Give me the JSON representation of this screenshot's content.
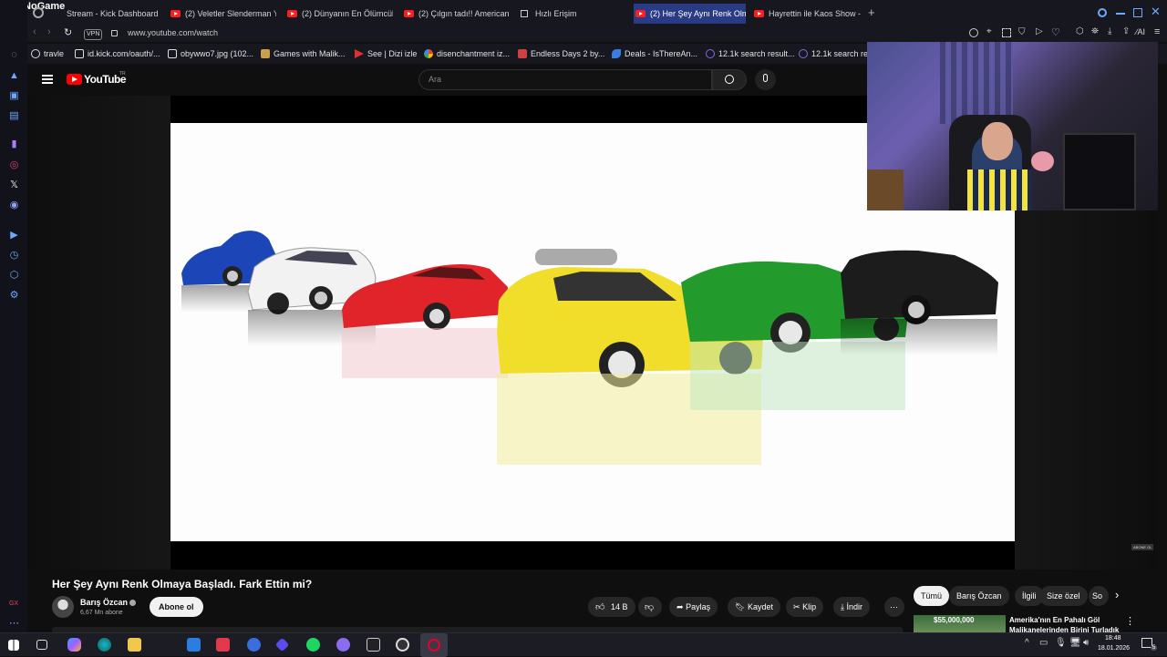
{
  "tabs": [
    {
      "label": "Stream - Kick Dashboard",
      "active": false
    },
    {
      "label": "(2) Veletler Slenderman Y...",
      "active": false
    },
    {
      "label": "(2) Dünyanın En Ölümcül K...",
      "active": false
    },
    {
      "label": "(2) Çılgın tadı!! American C...",
      "active": false
    },
    {
      "label": "Hızlı Erişim",
      "active": false
    },
    {
      "label": "(2) Her Şey Aynı Renk Olm...",
      "active": true
    },
    {
      "label": "Hayrettin ile Kaos Show - 2...",
      "active": false
    }
  ],
  "browser_brand": "ByNoGame",
  "address": {
    "vpn": "VPN",
    "url": "www.youtube.com/watch"
  },
  "bookmarks": [
    {
      "label": "travle",
      "color": "#e8e8e8"
    },
    {
      "label": "id.kick.com/oauth/...",
      "color": "#e8e8e8"
    },
    {
      "label": "obywwo7.jpg (102...",
      "color": "#e8e8e8"
    },
    {
      "label": "Games with Malik...",
      "color": "#c8a050"
    },
    {
      "label": "See | Dizi izle",
      "color": "#e03030"
    },
    {
      "label": "disenchantment iz...",
      "color": "#4a8af4"
    },
    {
      "label": "Endless Days 2 by...",
      "color": "#d04040"
    },
    {
      "label": "Deals - IsThereAn...",
      "color": "#3a7de0"
    },
    {
      "label": "12.1k search result...",
      "color": "#8a6bd6"
    },
    {
      "label": "12.1k search res",
      "color": "#8a6bd6"
    }
  ],
  "youtube": {
    "logo": "YouTube",
    "region": "TR",
    "search_placeholder": "Ara"
  },
  "video": {
    "title": "Her Şey Aynı Renk Olmaya Başladı. Fark Ettin mi?",
    "watermark": "ABONE OL"
  },
  "channel": {
    "name": "Barış Özcan",
    "subscribers": "6,67 Mn abone",
    "subscribe_label": "Abone ol"
  },
  "actions": {
    "likes": "14 B",
    "share": "Paylaş",
    "save": "Kaydet",
    "clip": "Klip",
    "download": "İndir"
  },
  "chips": [
    "Tümü",
    "Barış Özcan",
    "İlgili",
    "Size özel",
    "So"
  ],
  "recommendation": {
    "title": "Amerika'nın En Pahalı Göl Malikanelerinden Birini Turladık",
    "thumb_text": "$55,000,000"
  },
  "sidebar_label": "GX",
  "taskbar": {
    "time": "18:48",
    "date": "18.01.2026",
    "notif_count": "5"
  },
  "colors": {
    "yt_red": "#ff0000",
    "active_tab": "#2a3b85",
    "opera_accent": "#6fa8ff"
  }
}
